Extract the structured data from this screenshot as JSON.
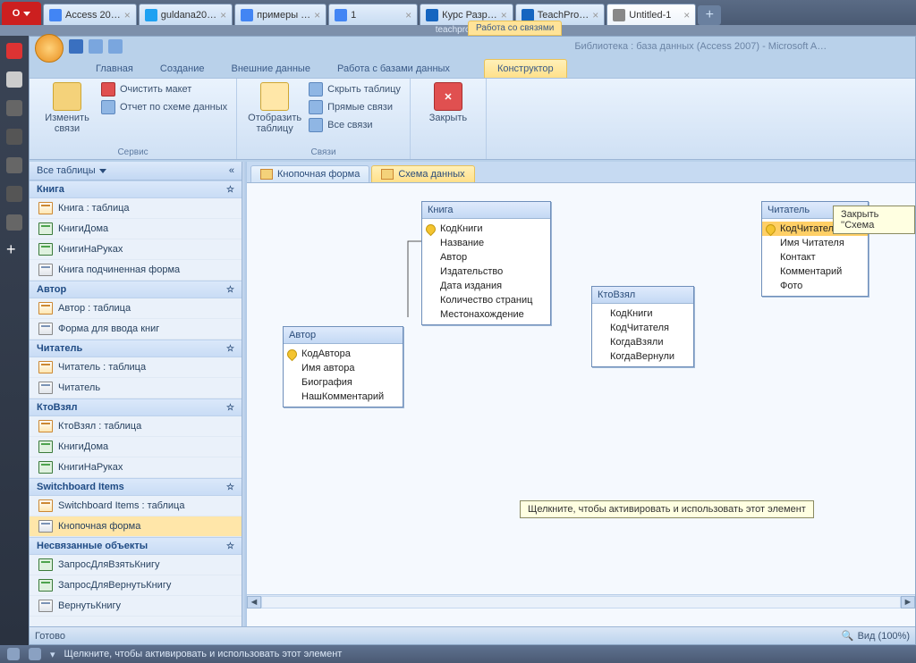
{
  "browser": {
    "tabs": [
      {
        "label": "Access 20…",
        "fav": "#4285f4"
      },
      {
        "label": "guldana20…",
        "fav": "#1da1f2"
      },
      {
        "label": "примеры …",
        "fav": "#4285f4"
      },
      {
        "label": "1",
        "fav": "#4285f4"
      },
      {
        "label": "Курс Разр…",
        "fav": "#1565c0"
      },
      {
        "label": "TeachPro…",
        "fav": "#1565c0"
      },
      {
        "label": "Untitled-1",
        "fav": "#888",
        "active": true
      }
    ],
    "address": "teachpro.ru",
    "status": "Щелкните, чтобы активировать и использовать этот элемент"
  },
  "context_tab": "Работа со связями",
  "app_title": "Библиотека : база данных (Access 2007)  -  Microsoft A…",
  "ribbon_tabs": [
    "Главная",
    "Создание",
    "Внешние данные",
    "Работа с базами данных"
  ],
  "ribbon_active": "Конструктор",
  "ribbon_groups": {
    "service": {
      "label": "Сервис",
      "big": "Изменить связи",
      "clear": "Очистить макет",
      "report": "Отчет по схеме данных"
    },
    "relations": {
      "label": "Связи",
      "show_table": "Отобразить таблицу",
      "hide": "Скрыть таблицу",
      "direct": "Прямые связи",
      "all": "Все связи"
    },
    "close": "Закрыть"
  },
  "nav": {
    "header": "Все таблицы",
    "groups": [
      {
        "title": "Книга",
        "items": [
          {
            "label": "Книга : таблица",
            "type": "table"
          },
          {
            "label": "КнигиДома",
            "type": "query"
          },
          {
            "label": "КнигиНаРуках",
            "type": "query"
          },
          {
            "label": "Книга подчиненная форма",
            "type": "form"
          }
        ]
      },
      {
        "title": "Автор",
        "items": [
          {
            "label": "Автор : таблица",
            "type": "table"
          },
          {
            "label": "Форма для ввода книг",
            "type": "form"
          }
        ]
      },
      {
        "title": "Читатель",
        "items": [
          {
            "label": "Читатель : таблица",
            "type": "table"
          },
          {
            "label": "Читатель",
            "type": "form"
          }
        ]
      },
      {
        "title": "КтоВзял",
        "items": [
          {
            "label": "КтоВзял : таблица",
            "type": "table"
          },
          {
            "label": "КнигиДома",
            "type": "query"
          },
          {
            "label": "КнигиНаРуках",
            "type": "query"
          }
        ]
      },
      {
        "title": "Switchboard Items",
        "items": [
          {
            "label": "Switchboard Items : таблица",
            "type": "table"
          },
          {
            "label": "Кнопочная форма",
            "type": "form",
            "selected": true
          }
        ]
      },
      {
        "title": "Несвязанные объекты",
        "items": [
          {
            "label": "ЗапросДляВзятьКнигу",
            "type": "query"
          },
          {
            "label": "ЗапросДляВернутьКнигу",
            "type": "query"
          },
          {
            "label": "ВернутьКнигу",
            "type": "form"
          }
        ]
      }
    ]
  },
  "doc_tabs": [
    {
      "label": "Кнопочная форма"
    },
    {
      "label": "Схема данных",
      "active": true
    }
  ],
  "tables": {
    "avtor": {
      "title": "Автор",
      "fields": [
        {
          "n": "КодАвтора",
          "pk": true
        },
        {
          "n": "Имя автора"
        },
        {
          "n": "Биография"
        },
        {
          "n": "НашКомментарий"
        }
      ]
    },
    "kniga": {
      "title": "Книга",
      "fields": [
        {
          "n": "КодКниги",
          "pk": true
        },
        {
          "n": "Название"
        },
        {
          "n": "Автор"
        },
        {
          "n": "Издательство"
        },
        {
          "n": "Дата издания"
        },
        {
          "n": "Количество страниц"
        },
        {
          "n": "Местонахождение"
        }
      ]
    },
    "kto": {
      "title": "КтоВзял",
      "fields": [
        {
          "n": "КодКниги"
        },
        {
          "n": "КодЧитателя"
        },
        {
          "n": "КогдаВзяли"
        },
        {
          "n": "КогдаВернули"
        }
      ]
    },
    "chit": {
      "title": "Читатель",
      "fields": [
        {
          "n": "КодЧитателя",
          "pk": true,
          "sel": true
        },
        {
          "n": "Имя Читателя"
        },
        {
          "n": "Контакт"
        },
        {
          "n": "Комментарий"
        },
        {
          "n": "Фото"
        }
      ]
    }
  },
  "tooltip_close": "Закрыть ''Схема",
  "tooltip_activate": "Щелкните, чтобы активировать и использовать этот элемент",
  "status": {
    "view": "Вид (100%)"
  }
}
